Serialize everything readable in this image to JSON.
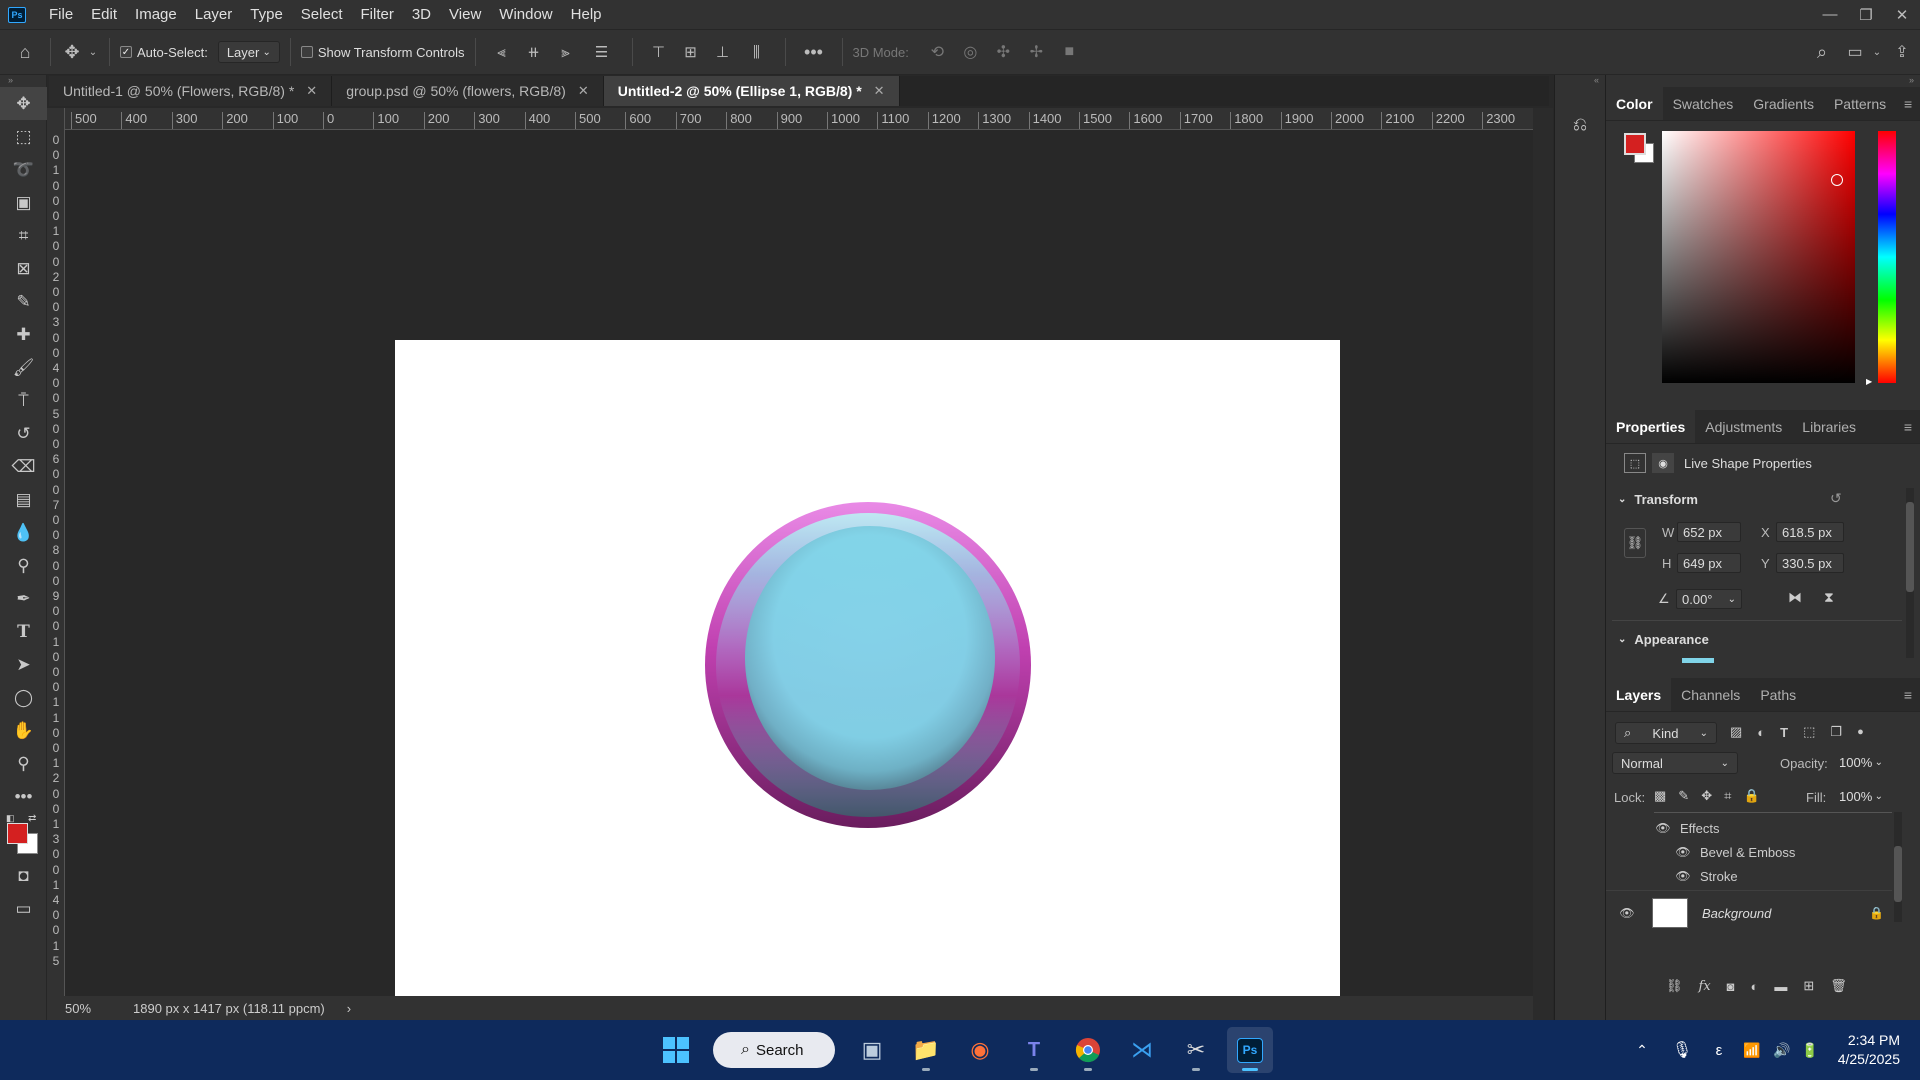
{
  "menu": [
    "File",
    "Edit",
    "Image",
    "Layer",
    "Type",
    "Select",
    "Filter",
    "3D",
    "View",
    "Window",
    "Help"
  ],
  "options_bar": {
    "auto_select_label": "Auto-Select:",
    "auto_select_value": "Layer",
    "show_transform_label": "Show Transform Controls",
    "mode_3d_label": "3D Mode:"
  },
  "tabs": [
    {
      "label": "Untitled-1 @ 50% (Flowers, RGB/8) *"
    },
    {
      "label": "group.psd @ 50% (flowers, RGB/8)"
    },
    {
      "label": "Untitled-2 @ 50% (Ellipse 1, RGB/8) *"
    }
  ],
  "ruler_h": [
    "500",
    "400",
    "300",
    "200",
    "100",
    "0",
    "100",
    "200",
    "300",
    "400",
    "500",
    "600",
    "700",
    "800",
    "900",
    "1000",
    "1100",
    "1200",
    "1300",
    "1400",
    "1500",
    "1600",
    "1700",
    "1800",
    "1900",
    "2000",
    "2100",
    "2200",
    "2300"
  ],
  "ruler_v": [
    "0",
    "0",
    "1",
    "0",
    "0",
    "0",
    "1",
    "0",
    "0",
    "2",
    "0",
    "0",
    "3",
    "0",
    "0",
    "4",
    "0",
    "0",
    "5",
    "0",
    "0",
    "6",
    "0",
    "0",
    "7",
    "0",
    "0",
    "8",
    "0",
    "0",
    "9",
    "0",
    "0",
    "1",
    "0",
    "0",
    "0",
    "1",
    "1",
    "0",
    "0",
    "1",
    "2",
    "0",
    "0",
    "1",
    "3",
    "0",
    "0",
    "1",
    "4",
    "0",
    "0",
    "1",
    "5"
  ],
  "status": {
    "zoom": "50%",
    "doc_info": "1890 px x 1417 px (118.11 ppcm)",
    "arrow": "›"
  },
  "color_panel": {
    "tabs": [
      "Color",
      "Swatches",
      "Gradients",
      "Patterns"
    ],
    "foreground": "#d42020",
    "background": "#ffffff"
  },
  "properties_panel": {
    "tabs": [
      "Properties",
      "Adjustments",
      "Libraries"
    ],
    "header": "Live Shape Properties",
    "transform_label": "Transform",
    "w_label": "W",
    "w_value": "652 px",
    "h_label": "H",
    "h_value": "649 px",
    "x_label": "X",
    "x_value": "618.5 px",
    "y_label": "Y",
    "y_value": "330.5 px",
    "angle_value": "0.00°",
    "appearance_label": "Appearance"
  },
  "layers_panel": {
    "tabs": [
      "Layers",
      "Channels",
      "Paths"
    ],
    "kind_label": "Kind",
    "blend_mode": "Normal",
    "opacity_label": "Opacity:",
    "opacity_value": "100%",
    "lock_label": "Lock:",
    "fill_label": "Fill:",
    "fill_value": "100%",
    "effects_label": "Effects",
    "effect_items": [
      "Bevel & Emboss",
      "Stroke"
    ],
    "background_layer": "Background"
  },
  "taskbar": {
    "search_label": "Search",
    "time": "2:34 PM",
    "date": "4/25/2025"
  },
  "artwork": {
    "ring_color_top": "#e680e0",
    "ring_color_bottom": "#6b1f5e",
    "fill_color": "#80d4e8"
  }
}
